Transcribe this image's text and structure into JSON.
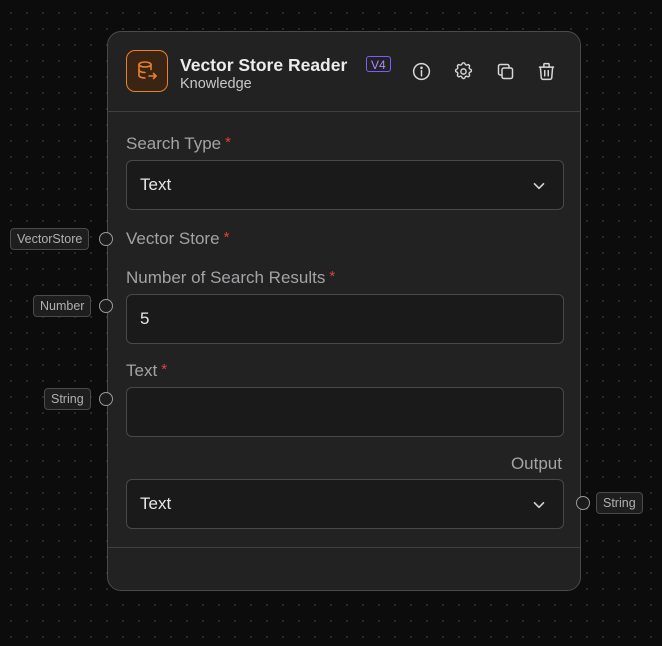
{
  "node": {
    "title": "Vector Store Reader",
    "version": "V4",
    "subtitle": "Knowledge",
    "icon": "database-export-icon",
    "accent_color": "#e8822b",
    "header_actions": [
      {
        "name": "info-icon"
      },
      {
        "name": "gear-icon"
      },
      {
        "name": "copy-icon"
      },
      {
        "name": "trash-icon"
      }
    ]
  },
  "fields": {
    "search_type": {
      "label": "Search Type",
      "required": "*",
      "value": "Text"
    },
    "vector_store": {
      "label": "Vector Store",
      "required": "*"
    },
    "num_results": {
      "label": "Number of Search Results",
      "required": "*",
      "value": "5"
    },
    "text": {
      "label": "Text",
      "required": "*",
      "value": ""
    },
    "output": {
      "label": "Output",
      "value": "Text"
    }
  },
  "ports": {
    "inputs": {
      "vector_store": "VectorStore",
      "num_results": "Number",
      "text": "String"
    },
    "output": "String"
  },
  "colors": {
    "required": "#e0413c",
    "version_badge": "#7c5cff"
  }
}
